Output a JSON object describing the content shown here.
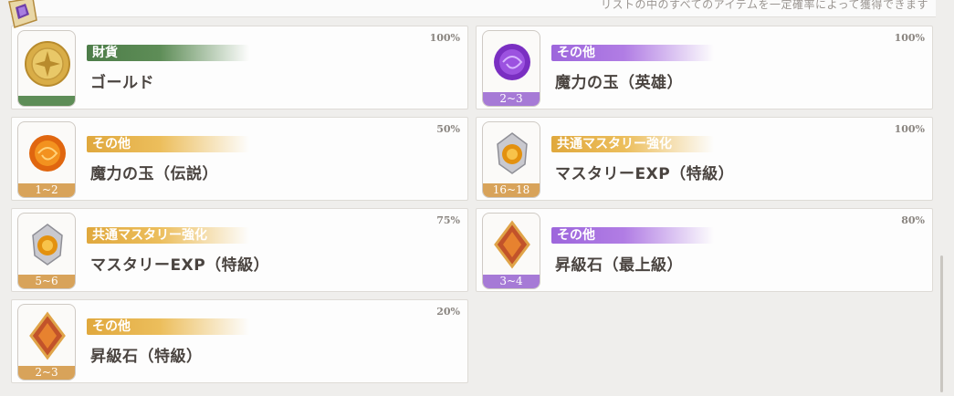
{
  "header": {
    "note": "リストの中のすべてのアイテムを一定確率によって獲得できます"
  },
  "items": [
    {
      "category": "財貨",
      "category_color": "green",
      "name": "ゴールド",
      "chance": "100%",
      "quantity": "",
      "icon": "gold-coin-icon"
    },
    {
      "category": "その他",
      "category_color": "purple",
      "name": "魔力の玉（英雄）",
      "chance": "100%",
      "quantity": "2~3",
      "icon": "purple-orb-icon"
    },
    {
      "category": "その他",
      "category_color": "orange",
      "name": "魔力の玉（伝説）",
      "chance": "50%",
      "quantity": "1~2",
      "icon": "orange-orb-icon"
    },
    {
      "category": "共通マスタリー強化",
      "category_color": "orange",
      "name": "マスタリーEXP（特級）",
      "chance": "100%",
      "quantity": "16~18",
      "icon": "mastery-gem-icon"
    },
    {
      "category": "共通マスタリー強化",
      "category_color": "orange",
      "name": "マスタリーEXP（特級）",
      "chance": "75%",
      "quantity": "5~6",
      "icon": "mastery-gem-icon"
    },
    {
      "category": "その他",
      "category_color": "purple",
      "name": "昇級石（最上級）",
      "chance": "80%",
      "quantity": "3~4",
      "icon": "ascension-stone-icon"
    },
    {
      "category": "その他",
      "category_color": "orange",
      "name": "昇級石（特級）",
      "chance": "20%",
      "quantity": "2~3",
      "icon": "ascension-stone-icon"
    }
  ]
}
